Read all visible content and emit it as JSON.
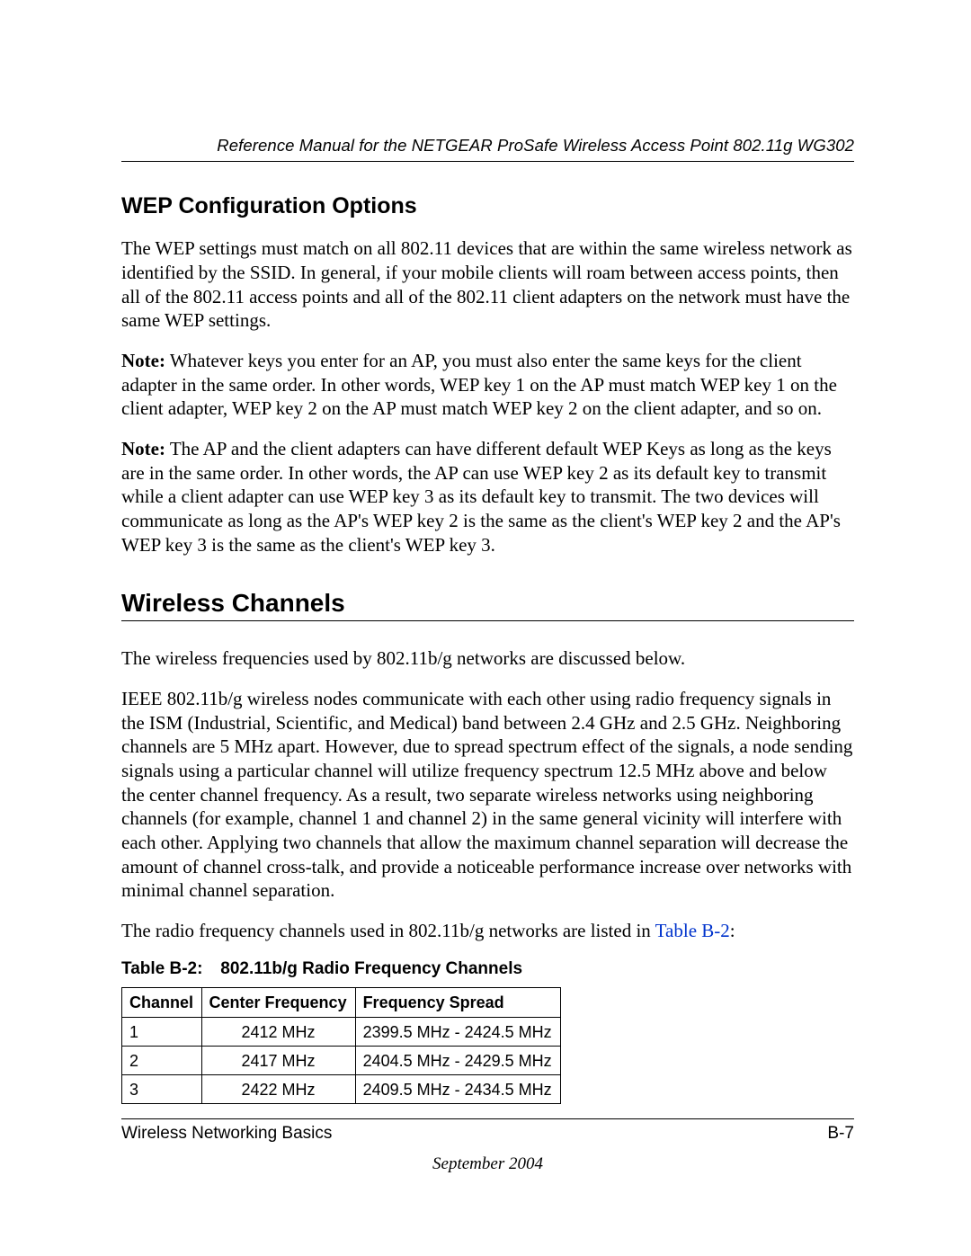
{
  "header": {
    "running_head": "Reference Manual for the NETGEAR ProSafe Wireless Access Point 802.11g WG302"
  },
  "sections": {
    "wep": {
      "title": "WEP Configuration Options",
      "p1": "The WEP settings must match on all 802.11 devices that are within the same wireless network as identified by the SSID. In general, if your mobile clients will roam between access points, then all of the 802.11 access points and all of the 802.11 client adapters on the network must have the same WEP settings.",
      "note1_label": "Note:",
      "note1_text": " Whatever keys you enter for an AP, you must also enter the same keys for the client adapter in the same order. In other words, WEP key 1 on the AP must match WEP key 1 on the client adapter, WEP key 2 on the AP must match WEP key 2 on the client adapter, and so on.",
      "note2_label": "Note:",
      "note2_text": " The AP and the client adapters can have different default WEP Keys as long as the keys are in the same order. In other words, the AP can use WEP key 2 as its default key to transmit while a client adapter can use WEP key 3 as its default key to transmit. The two devices will communicate as long as the AP's WEP key 2 is the same as the client's WEP key 2 and the AP's WEP key 3 is the same as the client's WEP key 3."
    },
    "channels": {
      "title": "Wireless Channels",
      "p1": "The wireless frequencies used by 802.11b/g networks are discussed below.",
      "p2": "IEEE 802.11b/g wireless nodes communicate with each other using radio frequency signals in the ISM (Industrial, Scientific, and Medical) band between 2.4 GHz and 2.5 GHz. Neighboring channels are 5 MHz apart. However, due to spread spectrum effect of the signals, a node sending signals using a particular channel will utilize frequency spectrum 12.5 MHz above and below the center channel frequency. As a result, two separate wireless networks using neighboring channels (for example, channel 1 and channel 2) in the same general vicinity will interfere with each other. Applying two channels that allow the maximum channel separation will decrease the amount of channel cross-talk, and provide a noticeable performance increase over networks with minimal channel separation.",
      "p3_pre": "The radio frequency channels used in 802.11b/g networks are listed in ",
      "p3_link": "Table B-2",
      "p3_post": ":"
    }
  },
  "table": {
    "label": "Table B-2:",
    "title": "802.11b/g Radio Frequency Channels",
    "headers": {
      "c1": "Channel",
      "c2": "Center Frequency",
      "c3": "Frequency Spread"
    },
    "rows": [
      {
        "ch": "1",
        "cf": "2412 MHz",
        "fs": "2399.5 MHz - 2424.5 MHz"
      },
      {
        "ch": "2",
        "cf": "2417 MHz",
        "fs": "2404.5 MHz - 2429.5 MHz"
      },
      {
        "ch": "3",
        "cf": "2422 MHz",
        "fs": "2409.5 MHz - 2434.5 MHz"
      }
    ]
  },
  "footer": {
    "left": "Wireless Networking Basics",
    "right": "B-7",
    "date": "September 2004"
  },
  "chart_data": {
    "type": "table",
    "title": "802.11b/g Radio Frequency Channels",
    "columns": [
      "Channel",
      "Center Frequency",
      "Frequency Spread"
    ],
    "rows": [
      [
        "1",
        "2412 MHz",
        "2399.5 MHz - 2424.5 MHz"
      ],
      [
        "2",
        "2417 MHz",
        "2404.5 MHz - 2429.5 MHz"
      ],
      [
        "3",
        "2422 MHz",
        "2409.5 MHz - 2434.5 MHz"
      ]
    ]
  }
}
